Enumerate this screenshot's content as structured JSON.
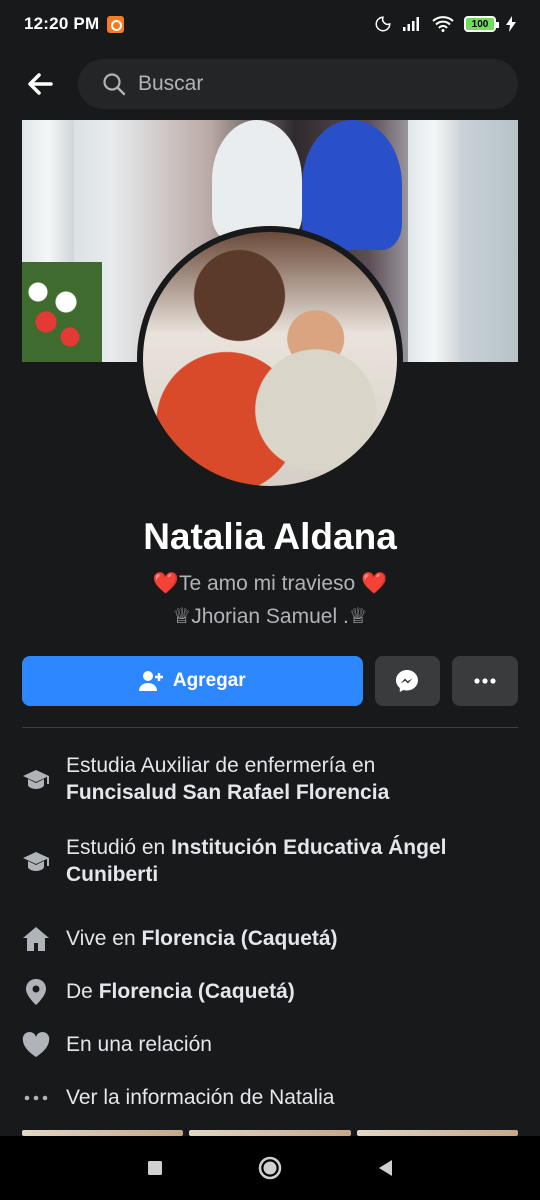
{
  "status_bar": {
    "time": "12:20 PM",
    "battery": "100"
  },
  "search": {
    "placeholder": "Buscar"
  },
  "profile": {
    "name": "Natalia Aldana",
    "bio_line1": "Te amo mi travieso",
    "bio_line2": "♕Jhorian Samuel .♕",
    "heart_emoji": "❤️"
  },
  "actions": {
    "add_friend_label": "Agregar"
  },
  "info": {
    "studies_prefix": "Estudia Auxiliar de enfermería en",
    "studies_place": "Funcisalud San Rafael Florencia",
    "studied_prefix": "Estudió en",
    "studied_place": "Institución Educativa Ángel Cuniberti",
    "lives_prefix": "Vive en",
    "lives_place": "Florencia (Caquetá)",
    "from_prefix": "De",
    "from_place": "Florencia (Caquetá)",
    "relationship": "En una relación",
    "see_info": "Ver la información de Natalia"
  },
  "colors": {
    "background": "#18191a",
    "primary_button": "#2d88ff",
    "secondary_button": "#3a3b3c",
    "heart": "#f02849"
  },
  "icons": {
    "back": "arrow-left-icon",
    "search": "search-icon",
    "add_friend": "person-plus-icon",
    "messenger": "messenger-icon",
    "more": "more-horizontal-icon",
    "education": "graduation-cap-icon",
    "home": "home-icon",
    "location": "location-pin-icon",
    "relationship": "heart-icon",
    "info": "ellipsis-icon"
  }
}
